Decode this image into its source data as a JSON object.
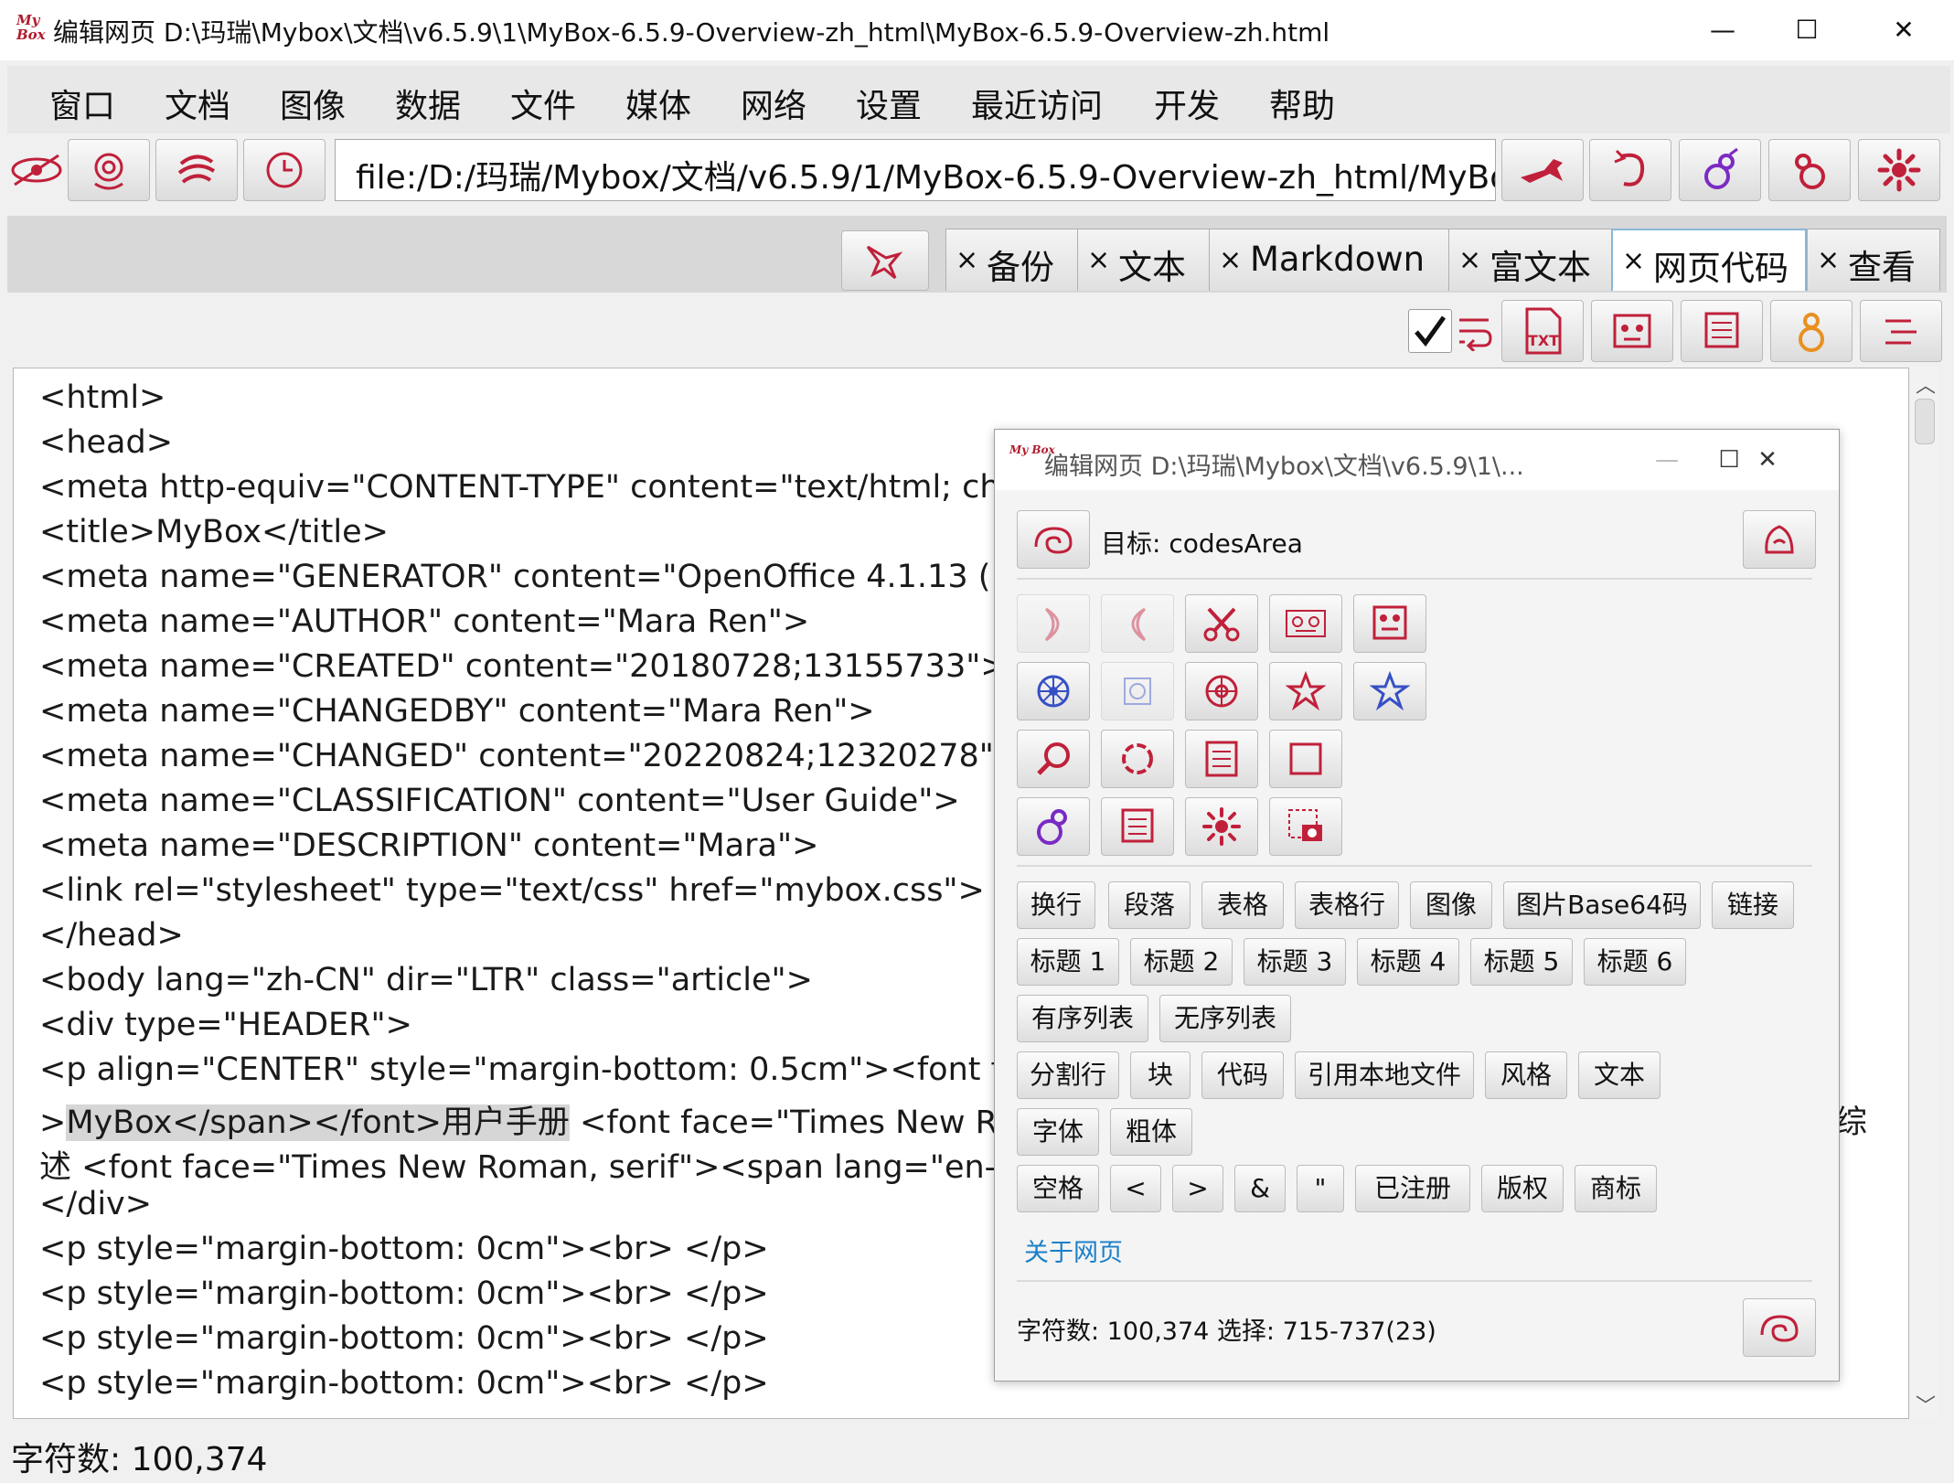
{
  "window": {
    "logo_text": "My Box",
    "title": "编辑网页  D:\\玛瑞\\Mybox\\文档\\v6.5.9\\1\\MyBox-6.5.9-Overview-zh_html\\MyBox-6.5.9-Overview-zh.html",
    "controls": {
      "minimize": "—",
      "maximize": "☐",
      "close": "✕"
    }
  },
  "menu": [
    "窗口",
    "文档",
    "图像",
    "数据",
    "文件",
    "媒体",
    "网络",
    "设置",
    "最近访问",
    "开发",
    "帮助"
  ],
  "toolbar": {
    "url": "file:/D:/玛瑞/Mybox/文档/v6.5.9/1/MyBox-6.5.9-Overview-zh_html/MyBox-6.5.9-Overview-zh.html",
    "left_icons": [
      "eye-icon",
      "peony-icon",
      "cloud-icon",
      "clock-icon"
    ],
    "right_icons": [
      "bird-icon",
      "refresh-icon",
      "gourd-icon",
      "gourd-outline-icon",
      "chrysanthemum-icon"
    ]
  },
  "tabs": [
    {
      "close": "×",
      "label": "备份"
    },
    {
      "close": "×",
      "label": "文本"
    },
    {
      "close": "×",
      "label": "Markdown"
    },
    {
      "close": "×",
      "label": "富文本"
    },
    {
      "close": "×",
      "label": "网页代码",
      "selected": true
    },
    {
      "close": "×",
      "label": "查看"
    }
  ],
  "toolbar2": {
    "checked": true,
    "icons": [
      "wrap-icon",
      "txt-icon",
      "mask-icon",
      "panel-icon",
      "gourd-icon",
      "align-icon"
    ]
  },
  "code_lines": [
    "<html>",
    " <head>",
    "  <meta http-equiv=\"CONTENT-TYPE\" content=\"text/html; ch",
    "  <title>MyBox</title>",
    "  <meta name=\"GENERATOR\" content=\"OpenOffice 4.1.13  (",
    "  <meta name=\"AUTHOR\" content=\"Mara Ren\">",
    "  <meta name=\"CREATED\" content=\"20180728;13155733\">",
    "  <meta name=\"CHANGEDBY\" content=\"Mara Ren\">",
    "  <meta name=\"CHANGED\" content=\"20220824;12320278\">",
    "  <meta name=\"CLASSIFICATION\" content=\"User Guide\">",
    "  <meta name=\"DESCRIPTION\" content=\"Mara\">",
    "  <link rel=\"stylesheet\" type=\"text/css\" href=\"mybox.css\">",
    " </head>",
    " <body lang=\"zh-CN\" dir=\"LTR\" class=\"article\">",
    "  <div type=\"HEADER\">",
    "   <p align=\"CENTER\" style=\"margin-bottom: 0.5cm\"><font f"
  ],
  "code_highlight_line": {
    "prefix": ">",
    "highlight": "MyBox</span></font>用户手册",
    "suffix": " <font face=\"Times New Ro",
    "tail": "综"
  },
  "code_lines_after": [
    "述 <font face=\"Times New Roman, serif\"><span lang=\"en-U",
    "  </div>",
    "  <p style=\"margin-bottom: 0cm\"><br> </p>",
    "  <p style=\"margin-bottom: 0cm\"><br> </p>",
    "  <p style=\"margin-bottom: 0cm\"><br> </p>",
    "  <p style=\"margin-bottom: 0cm\"><br> </p>"
  ],
  "status": "字符数: 100,374",
  "popup": {
    "logo_text": "My Box",
    "title": "编辑网页  D:\\玛瑞\\Mybox\\文档\\v6.5.9\\1\\...",
    "controls": {
      "minimize": "—",
      "maximize": "☐",
      "close": "✕"
    },
    "target": "目标: codesArea",
    "rows": [
      [
        "换行",
        "段落",
        "表格",
        "表格行",
        "图像",
        "图片Base64码",
        "链接"
      ],
      [
        "标题 1",
        "标题 2",
        "标题 3",
        "标题 4",
        "标题 5",
        "标题 6"
      ],
      [
        "有序列表",
        "无序列表"
      ],
      [
        "分割行",
        "块",
        "代码",
        "引用本地文件",
        "风格",
        "文本"
      ],
      [
        "字体",
        "粗体"
      ],
      [
        "空格",
        "<",
        ">",
        "&",
        "\"",
        "已注册",
        "版权",
        "商标"
      ]
    ],
    "about_link": "关于网页",
    "status": "字符数: 100,374  选择: 715-737(23)"
  }
}
